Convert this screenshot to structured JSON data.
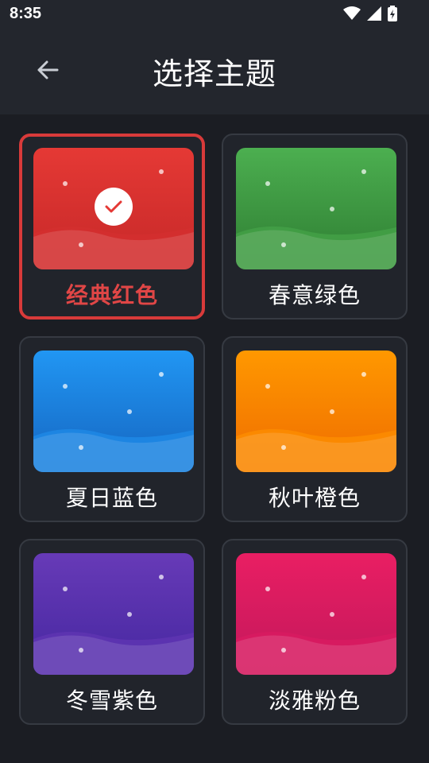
{
  "status_bar": {
    "time": "8:35"
  },
  "header": {
    "title": "选择主题"
  },
  "themes": [
    {
      "label": "经典红色",
      "selected": true,
      "top": "#e53935",
      "mid": "#d32f2f",
      "wave": "#c62828"
    },
    {
      "label": "春意绿色",
      "selected": false,
      "top": "#4caf50",
      "mid": "#43a047",
      "wave": "#2e7d32"
    },
    {
      "label": "夏日蓝色",
      "selected": false,
      "top": "#2196f3",
      "mid": "#1e88e5",
      "wave": "#1565c0"
    },
    {
      "label": "秋叶橙色",
      "selected": false,
      "top": "#ff9800",
      "mid": "#fb8c00",
      "wave": "#ef6c00"
    },
    {
      "label": "冬雪紫色",
      "selected": false,
      "top": "#673ab7",
      "mid": "#5e35b1",
      "wave": "#4527a0"
    },
    {
      "label": "淡雅粉色",
      "selected": false,
      "top": "#e91e63",
      "mid": "#d81b60",
      "wave": "#c2185b"
    }
  ],
  "icons": {
    "back": "arrow-left-icon",
    "check": "check-icon"
  }
}
